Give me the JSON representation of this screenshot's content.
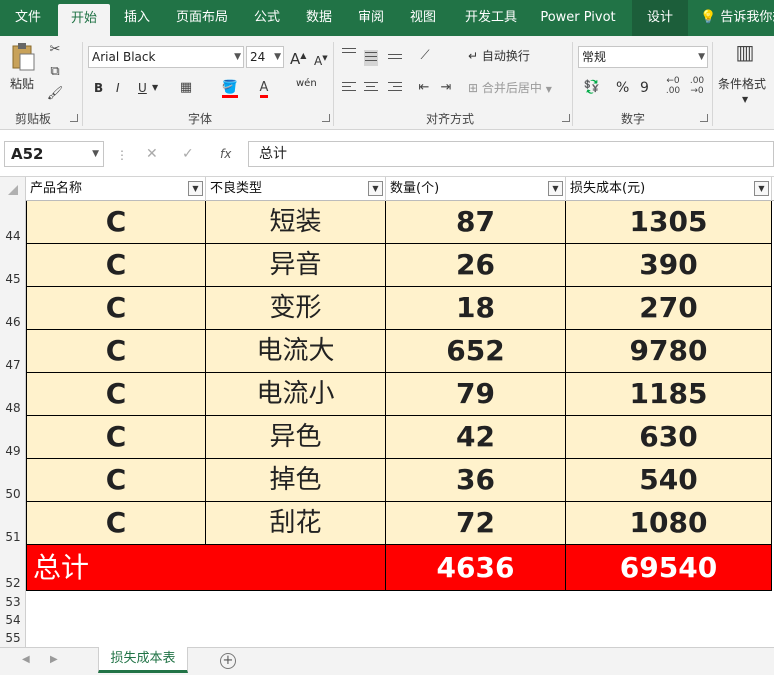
{
  "ribbon_tabs": [
    "文件",
    "开始",
    "插入",
    "页面布局",
    "公式",
    "数据",
    "审阅",
    "视图",
    "开发工具",
    "Power Pivot",
    "设计"
  ],
  "tell_me": "告诉我你想",
  "clipboard": {
    "paste": "粘贴",
    "label": "剪贴板"
  },
  "font": {
    "name": "Arial Black",
    "size": "24",
    "grow": "A",
    "shrink": "A",
    "bold": "B",
    "italic": "I",
    "underline": "U",
    "label": "字体",
    "wen": "wén"
  },
  "alignment": {
    "wrap": "自动换行",
    "merge": "合并后居中",
    "label": "对齐方式"
  },
  "number": {
    "format": "常规",
    "percent": "%",
    "comma": "9",
    "label": "数字"
  },
  "styles": {
    "conditional": "条件格式"
  },
  "formula_bar": {
    "name_box": "A52",
    "cancel": "✕",
    "enter": "✓",
    "fx": "fx",
    "value": "总计"
  },
  "columns": [
    "产品名称",
    "不良类型",
    "数量(个)",
    "损失成本(元)"
  ],
  "rows": [
    {
      "num": "44",
      "product": "C",
      "type": "短装",
      "qty": "87",
      "cost": "1305"
    },
    {
      "num": "45",
      "product": "C",
      "type": "异音",
      "qty": "26",
      "cost": "390"
    },
    {
      "num": "46",
      "product": "C",
      "type": "变形",
      "qty": "18",
      "cost": "270"
    },
    {
      "num": "47",
      "product": "C",
      "type": "电流大",
      "qty": "652",
      "cost": "9780"
    },
    {
      "num": "48",
      "product": "C",
      "type": "电流小",
      "qty": "79",
      "cost": "1185"
    },
    {
      "num": "49",
      "product": "C",
      "type": "异色",
      "qty": "42",
      "cost": "630"
    },
    {
      "num": "50",
      "product": "C",
      "type": "掉色",
      "qty": "36",
      "cost": "540"
    },
    {
      "num": "51",
      "product": "C",
      "type": "刮花",
      "qty": "72",
      "cost": "1080"
    }
  ],
  "total_row": {
    "num": "52",
    "label": "总计",
    "qty": "4636",
    "cost": "69540"
  },
  "empty_rows": [
    "53",
    "54",
    "55"
  ],
  "sheet_tab": "损失成本表",
  "colors": {
    "excel_green": "#217346",
    "cell_fill": "#fff2cc",
    "total_fill": "#ff0000"
  }
}
